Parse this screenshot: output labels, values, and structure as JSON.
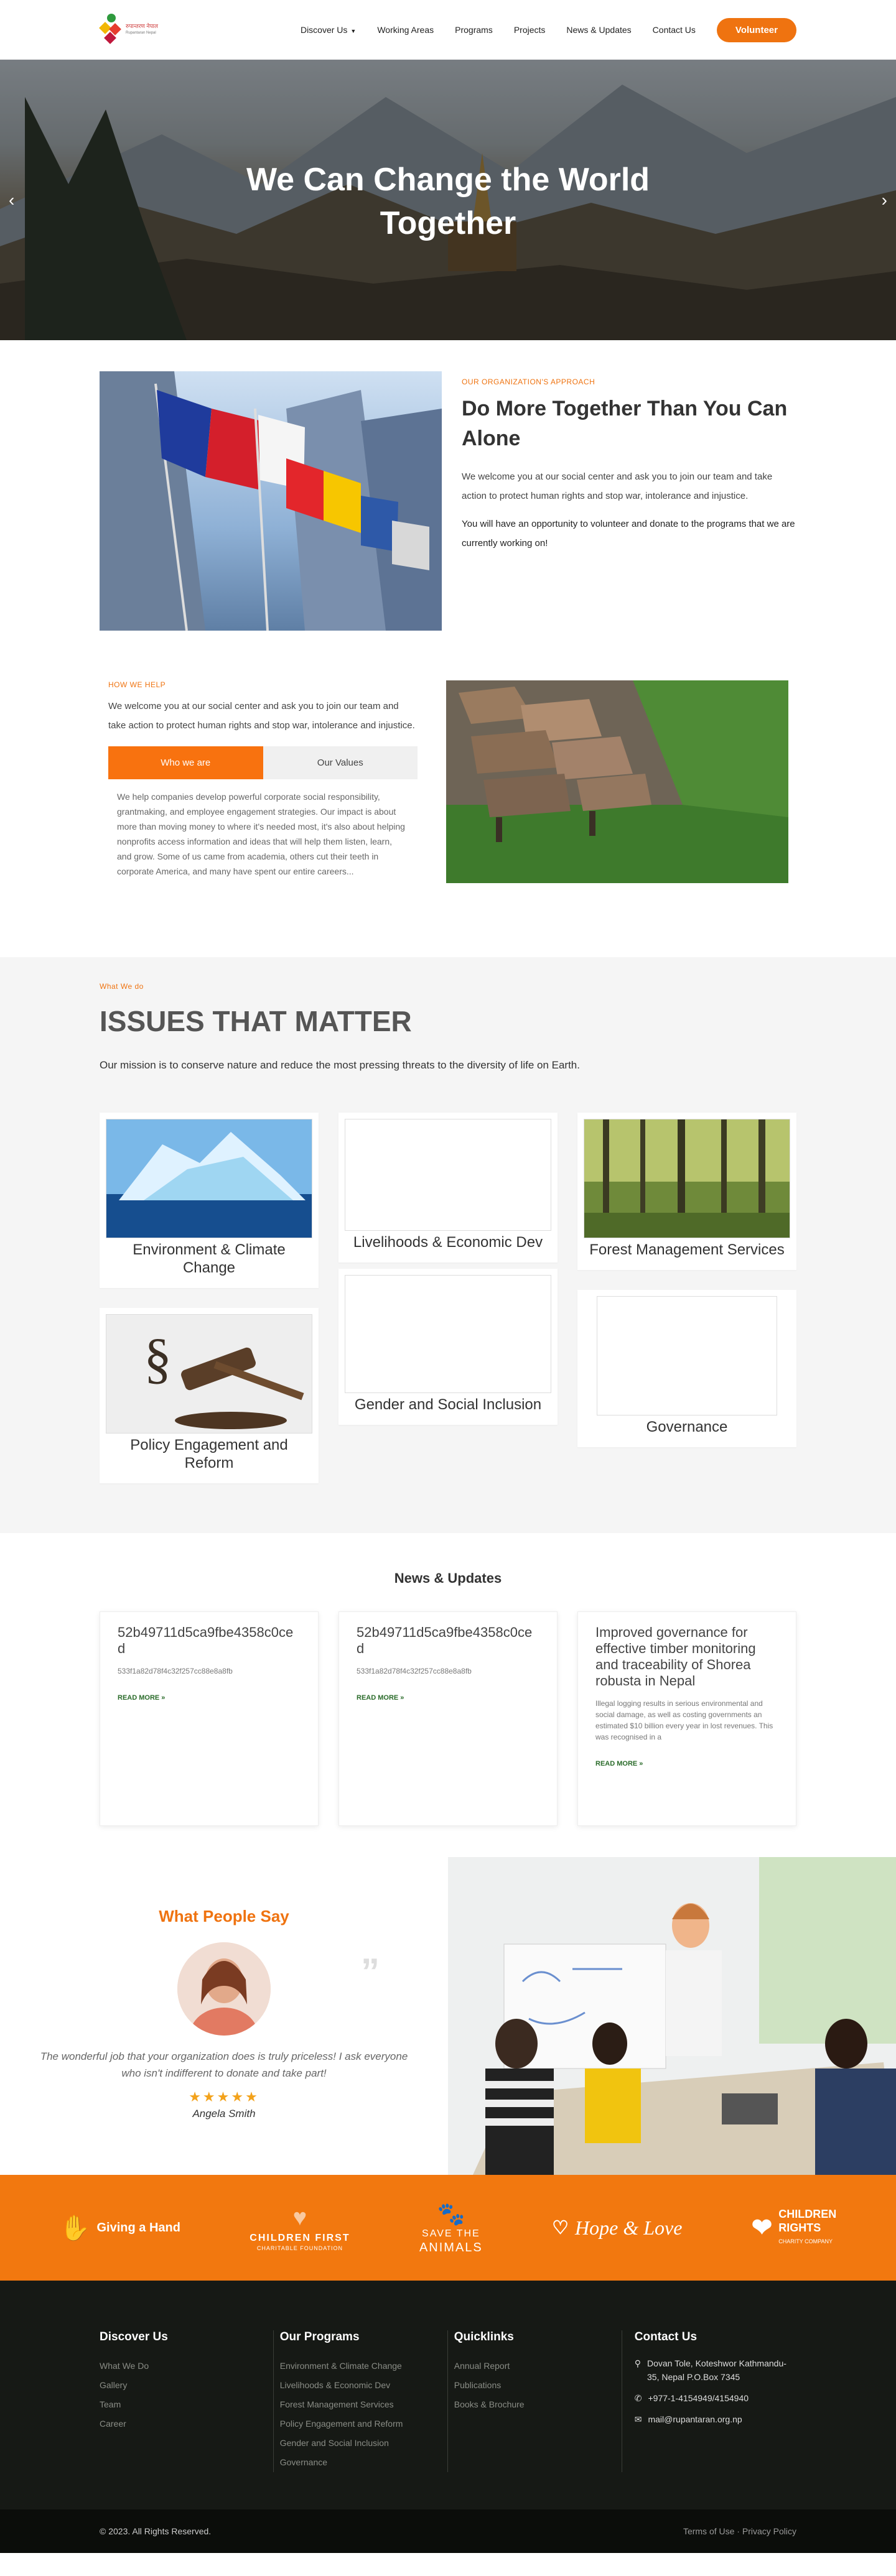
{
  "brand": {
    "logo_text": "रुपान्तरण नेपाल",
    "logo_sub": "Rupantaran Nepal",
    "colors": {
      "accent": "#ef7310",
      "dark": "#161915"
    }
  },
  "nav": {
    "items": [
      "Discover Us",
      "Working Areas",
      "Programs",
      "Projects",
      "News & Updates",
      "Contact Us"
    ],
    "cta": "Volunteer"
  },
  "hero": {
    "title_line1": "We Can Change the World",
    "title_line2": "Together"
  },
  "approach": {
    "eyebrow": "OUR ORGANIZATION'S APPROACH",
    "title": "Do More Together Than You Can Alone",
    "p1": "We welcome you at our social center and ask you to join our team and take action to protect human rights and stop war, intolerance and injustice.",
    "p2": "You will have an opportunity to volunteer and donate to the programs that we are currently working on!"
  },
  "help": {
    "eyebrow": "HOW WE HELP",
    "intro": "We welcome you at our social center and ask you to join our team and take action to protect human rights and stop war, intolerance and injustice.",
    "tabs": [
      "Who we are",
      "Our Values"
    ],
    "body": "We help companies develop powerful corporate social responsibility, grantmaking, and employee engagement strategies. Our impact is about more than moving money to where it's needed most, it's also about helping nonprofits access information and ideas that will help them listen, learn, and grow. Some of us came from academia, others cut their teeth in corporate America, and many have spent our entire careers..."
  },
  "issues": {
    "eyebrow": "What We do",
    "title": "ISSUES THAT MATTER",
    "mission": "Our mission is to conserve nature and reduce the most pressing threats to the diversity of life on Earth.",
    "cards": [
      "Environment & Climate Change",
      "Livelihoods & Economic Dev",
      "Forest Management Services",
      "Policy Engagement and Reform",
      "Gender and Social Inclusion",
      "Governance"
    ]
  },
  "news": {
    "title": "News & Updates",
    "items": [
      {
        "title": "52b49711d5ca9fbe4358c0ced",
        "excerpt": "533f1a82d78f4c32f257cc88e8a8fb",
        "more": "READ MORE »"
      },
      {
        "title": "52b49711d5ca9fbe4358c0ced",
        "excerpt": "533f1a82d78f4c32f257cc88e8a8fb",
        "more": "READ MORE »"
      },
      {
        "title": "Improved governance for effective timber monitoring and traceability of Shorea robusta in Nepal",
        "excerpt": "Illegal logging results in serious environmental and social damage, as well as costing governments an estimated $10 billion every year in lost revenues. This was recognised in a",
        "more": "READ MORE »"
      }
    ]
  },
  "testimonial": {
    "title": "What People Say",
    "quote": "The wonderful job that your organization does is truly priceless! I ask everyone who isn't indifferent to donate and take part!",
    "stars": "★★★★★",
    "author": "Angela Smith"
  },
  "partners": [
    {
      "name": "Giving a Hand"
    },
    {
      "name": "CHILDREN FIRST",
      "sub": "CHARITABLE FOUNDATION"
    },
    {
      "name": "SAVE THE",
      "sub": "ANIMALS"
    },
    {
      "name": "Hope & Love"
    },
    {
      "name": "CHILDREN",
      "name2": "RIGHTS",
      "sub": "CHARITY COMPANY"
    }
  ],
  "footer": {
    "discover": {
      "title": "Discover Us",
      "links": [
        "What We Do",
        "Gallery",
        "Team",
        "Career"
      ]
    },
    "programs": {
      "title": "Our Programs",
      "links": [
        "Environment & Climate Change",
        "Livelihoods & Economic Dev",
        "Forest Management Services",
        "Policy Engagement and Reform",
        "Gender and Social Inclusion",
        "Governance"
      ]
    },
    "quicklinks": {
      "title": "Quicklinks",
      "links": [
        "Annual Report",
        "Publications",
        "Books & Brochure"
      ]
    },
    "contact": {
      "title": "Contact Us",
      "address": "Dovan Tole, Koteshwor Kathmandu-35, Nepal P.O.Box 7345",
      "phone": "+977-1-4154949/4154940",
      "email": "mail@rupantaran.org.np"
    }
  },
  "copyright": "© 2023. All Rights Reserved.",
  "legal": [
    "Terms of Use",
    "Privacy Policy"
  ]
}
